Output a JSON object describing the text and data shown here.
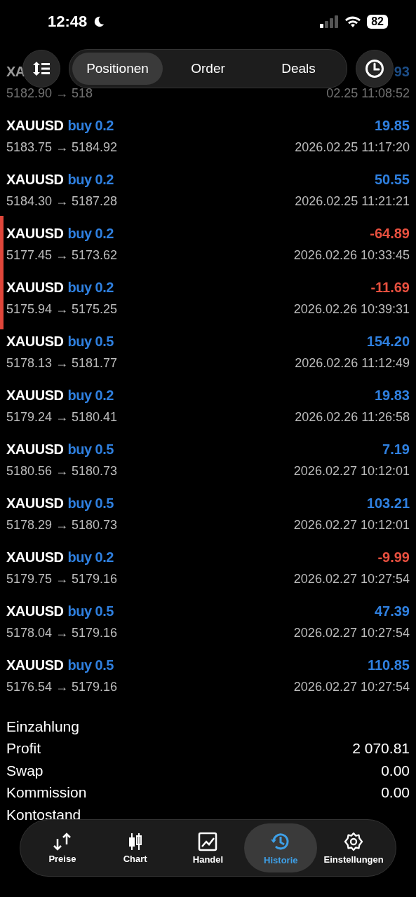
{
  "status_bar": {
    "time": "12:48",
    "battery": "82"
  },
  "toolbar": {
    "tabs": [
      {
        "label": "Positionen",
        "selected": true
      },
      {
        "label": "Order",
        "selected": false
      },
      {
        "label": "Deals",
        "selected": false
      }
    ]
  },
  "deals": [
    {
      "symbol": "XA",
      "profit": "93",
      "prices": "5182.90 → 518",
      "time": "02.25 11:08:52",
      "loss": false,
      "flagged": false,
      "faded": true
    },
    {
      "symbol": "XAUUSD",
      "side": "buy 0.2",
      "profit": "19.85",
      "prices": "5183.75 → 5184.92",
      "time": "2026.02.25 11:17:20",
      "loss": false,
      "flagged": false,
      "faded": false
    },
    {
      "symbol": "XAUUSD",
      "side": "buy 0.2",
      "profit": "50.55",
      "prices": "5184.30 → 5187.28",
      "time": "2026.02.25 11:21:21",
      "loss": false,
      "flagged": false,
      "faded": false
    },
    {
      "symbol": "XAUUSD",
      "side": "buy 0.2",
      "profit": "-64.89",
      "prices": "5177.45 → 5173.62",
      "time": "2026.02.26 10:33:45",
      "loss": true,
      "flagged": true,
      "faded": false
    },
    {
      "symbol": "XAUUSD",
      "side": "buy 0.2",
      "profit": "-11.69",
      "prices": "5175.94 → 5175.25",
      "time": "2026.02.26 10:39:31",
      "loss": true,
      "flagged": true,
      "faded": false
    },
    {
      "symbol": "XAUUSD",
      "side": "buy 0.5",
      "profit": "154.20",
      "prices": "5178.13 → 5181.77",
      "time": "2026.02.26 11:12:49",
      "loss": false,
      "flagged": false,
      "faded": false
    },
    {
      "symbol": "XAUUSD",
      "side": "buy 0.2",
      "profit": "19.83",
      "prices": "5179.24 → 5180.41",
      "time": "2026.02.26 11:26:58",
      "loss": false,
      "flagged": false,
      "faded": false
    },
    {
      "symbol": "XAUUSD",
      "side": "buy 0.5",
      "profit": "7.19",
      "prices": "5180.56 → 5180.73",
      "time": "2026.02.27 10:12:01",
      "loss": false,
      "flagged": false,
      "faded": false
    },
    {
      "symbol": "XAUUSD",
      "side": "buy 0.5",
      "profit": "103.21",
      "prices": "5178.29 → 5180.73",
      "time": "2026.02.27 10:12:01",
      "loss": false,
      "flagged": false,
      "faded": false
    },
    {
      "symbol": "XAUUSD",
      "side": "buy 0.2",
      "profit": "-9.99",
      "prices": "5179.75 → 5179.16",
      "time": "2026.02.27 10:27:54",
      "loss": true,
      "flagged": false,
      "faded": false
    },
    {
      "symbol": "XAUUSD",
      "side": "buy 0.5",
      "profit": "47.39",
      "prices": "5178.04 → 5179.16",
      "time": "2026.02.27 10:27:54",
      "loss": false,
      "flagged": false,
      "faded": false
    },
    {
      "symbol": "XAUUSD",
      "side": "buy 0.5",
      "profit": "110.85",
      "prices": "5176.54 → 5179.16",
      "time": "2026.02.27 10:27:54",
      "loss": false,
      "flagged": false,
      "faded": false
    }
  ],
  "summary": [
    {
      "label": "Einzahlung"
    },
    {
      "label": "Profit",
      "value": "2 070.81"
    },
    {
      "label": "Swap",
      "value": "0.00"
    },
    {
      "label": "Kommission",
      "value": "0.00"
    },
    {
      "label": "Kontostand"
    }
  ],
  "nav": [
    {
      "label": "Preise",
      "kind": "prices",
      "selected": false
    },
    {
      "label": "Chart",
      "kind": "chart",
      "selected": false
    },
    {
      "label": "Handel",
      "kind": "trade",
      "selected": false
    },
    {
      "label": "Historie",
      "kind": "history",
      "selected": true
    },
    {
      "label": "Einstellungen",
      "kind": "settings",
      "selected": false
    }
  ]
}
